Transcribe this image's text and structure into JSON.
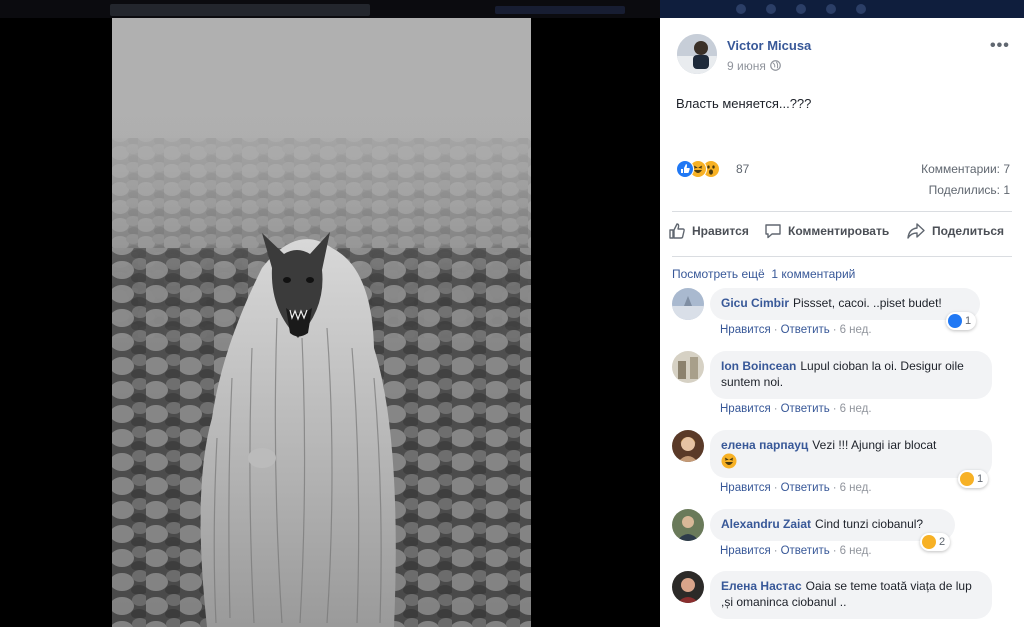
{
  "post": {
    "author": "Victor Micusa",
    "date": "9 июня",
    "text": "Власть меняется...???",
    "reaction_count": "87",
    "comments_label": "Комментарии: 7",
    "shares_label": "Поделились: 1"
  },
  "actions": {
    "like": "Нравится",
    "comment": "Комментировать",
    "share": "Поделиться"
  },
  "more_comments": "Посмотреть ещё  1 комментарий",
  "comment_links": {
    "like": "Нравится",
    "reply": "Ответить",
    "sep": "·"
  },
  "comments": [
    {
      "name": "Gicu Cimbir",
      "text": "Pissset, cacoi. ..piset budet!",
      "time": "6 нед.",
      "reaction_count": "1",
      "reaction": "like-icon"
    },
    {
      "name": "Ion Boincean",
      "text": "Lupul cioban la oi. Desigur oile suntem noi.",
      "time": "6 нед.",
      "reaction_count": "",
      "reaction": ""
    },
    {
      "name": "елена парпауц",
      "text": "Vezi !!! Ajungi iar blocat",
      "time": "6 нед.",
      "reaction_count": "1",
      "reaction": "wow-icon"
    },
    {
      "name": "Alexandru Zaiat",
      "text": "Cind tunzi ciobanul?",
      "time": "6 нед.",
      "reaction_count": "2",
      "reaction": "haha-icon"
    },
    {
      "name": "Елена Настас",
      "text": "Oaia se teme toată viața de lup ,și omaninca ciobanul ..",
      "time": "",
      "reaction_count": "",
      "reaction": ""
    }
  ],
  "colors": {
    "link": "#385898",
    "like_blue": "#2078f4",
    "emoji_yellow": "#f7b125"
  }
}
